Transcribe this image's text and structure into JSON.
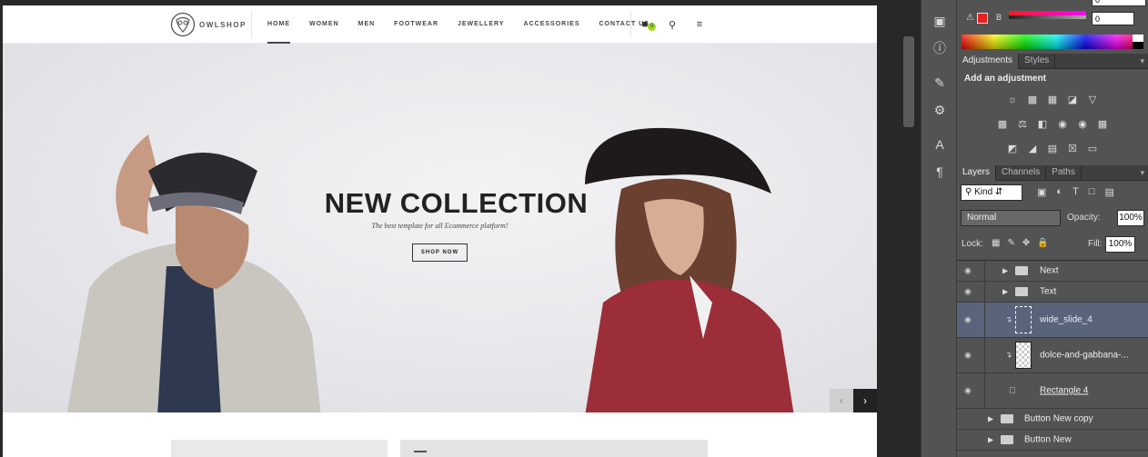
{
  "store": {
    "logo_text": "OWLSHOP",
    "menu": [
      "HOME",
      "WOMEN",
      "MEN",
      "FOOTWEAR",
      "JEWELLERY",
      "ACCESSORIES",
      "CONTACT US"
    ],
    "cart_count": "0",
    "hero": {
      "title": "NEW COLLECTION",
      "subtitle": "The best template for all Ecommerce platform!",
      "button": "SHOP NOW"
    }
  },
  "color_panel": {
    "b_label": "B",
    "value_top": "0",
    "value_b": "0",
    "fg_color": "#e82020"
  },
  "adjustments": {
    "tabs": [
      "Adjustments",
      "Styles"
    ],
    "heading": "Add an adjustment"
  },
  "layers_panel": {
    "tabs": [
      "Layers",
      "Channels",
      "Paths"
    ],
    "filter_kind": "Kind",
    "blend_mode": "Normal",
    "opacity_label": "Opacity:",
    "opacity_value": "100%",
    "lock_label": "Lock:",
    "fill_label": "Fill:",
    "fill_value": "100%",
    "layers": [
      {
        "name": "Next",
        "type": "group"
      },
      {
        "name": "Text",
        "type": "group"
      },
      {
        "name": "wide_slide_4",
        "type": "smart-object",
        "selected": true
      },
      {
        "name": "dolce-and-gabbana-...",
        "type": "image"
      },
      {
        "name": "Rectangle 4",
        "type": "shape"
      },
      {
        "name": "Button New  copy",
        "type": "group"
      },
      {
        "name": "Button New",
        "type": "group"
      }
    ]
  }
}
